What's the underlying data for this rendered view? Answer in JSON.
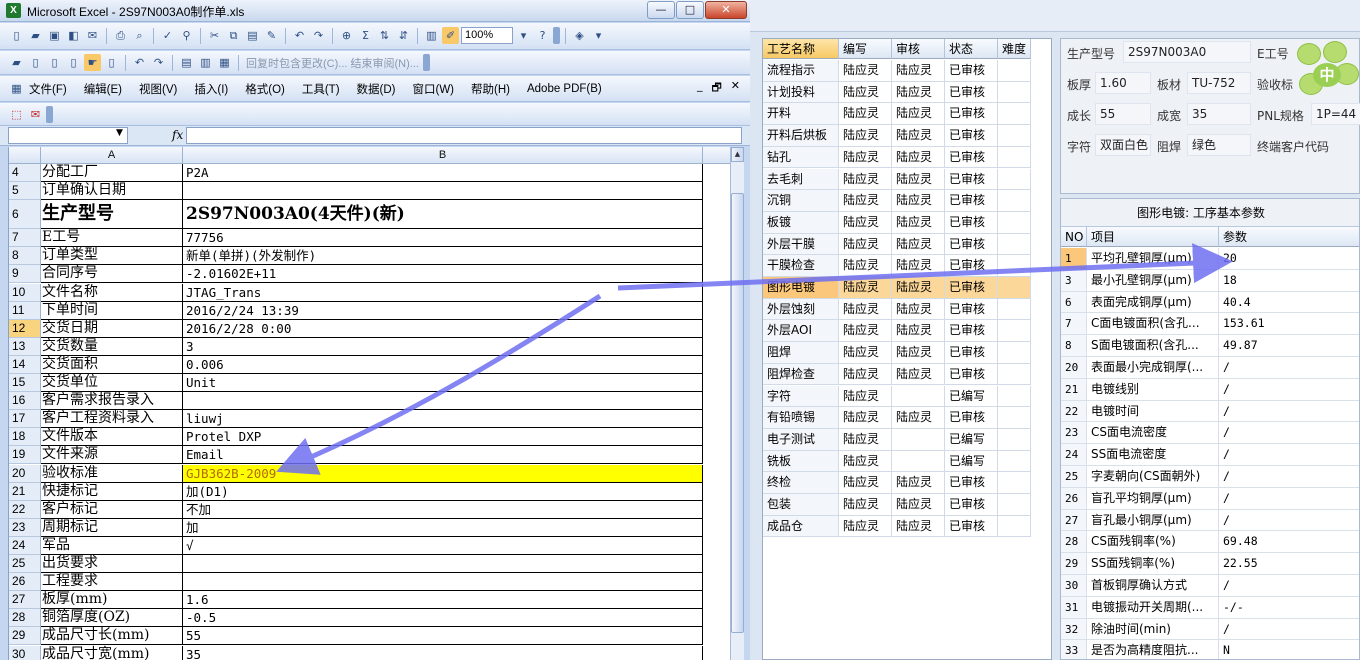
{
  "excel": {
    "title": "Microsoft Excel - 2S97N003A0制作单.xls",
    "app_icon": "X",
    "window_buttons": {
      "minimize": "—",
      "maximize": "□",
      "close": "✕"
    },
    "zoom": "100%",
    "toolbar2_disabled_text": "回复时包含更改(C)... 结束审阅(N)...",
    "menus": [
      "文件(F)",
      "编辑(E)",
      "视图(V)",
      "插入(I)",
      "格式(O)",
      "工具(T)",
      "数据(D)",
      "窗口(W)",
      "帮助(H)",
      "Adobe PDF(B)"
    ],
    "mdi_buttons": {
      "minimize": "_",
      "restore": "🗗",
      "close": "✕"
    },
    "fx": "fx",
    "columns": [
      "A",
      "B"
    ],
    "rows": [
      {
        "num": "4",
        "a": "分配工厂",
        "b": "P2A"
      },
      {
        "num": "5",
        "a": "订单确认日期",
        "b": ""
      },
      {
        "num": "6",
        "a": "生产型号",
        "b": "2S97N003A0(4天件)(新)"
      },
      {
        "num": "7",
        "a": "E工号",
        "b": "77756"
      },
      {
        "num": "8",
        "a": "订单类型",
        "b": "新单(单拼)(外发制作)"
      },
      {
        "num": "9",
        "a": "合同序号",
        "b": "-2.01602E+11"
      },
      {
        "num": "10",
        "a": "文件名称",
        "b": "JTAG_Trans"
      },
      {
        "num": "11",
        "a": "下单时间",
        "b": "2016/2/24 13:39"
      },
      {
        "num": "12",
        "a": "交货日期",
        "b": "2016/2/28 0:00"
      },
      {
        "num": "13",
        "a": "交货数量",
        "b": "3"
      },
      {
        "num": "14",
        "a": "交货面积",
        "b": "0.006"
      },
      {
        "num": "15",
        "a": "交货单位",
        "b": "Unit"
      },
      {
        "num": "16",
        "a": "客户需求报告录入",
        "b": ""
      },
      {
        "num": "17",
        "a": "客户工程资料录入",
        "b": "liuwj"
      },
      {
        "num": "18",
        "a": "文件版本",
        "b": "Protel DXP"
      },
      {
        "num": "19",
        "a": "文件来源",
        "b": "Email"
      },
      {
        "num": "20",
        "a": "验收标准",
        "b": "GJB362B-2009"
      },
      {
        "num": "21",
        "a": "快捷标记",
        "b": "加(D1)"
      },
      {
        "num": "22",
        "a": "客户标记",
        "b": "不加"
      },
      {
        "num": "23",
        "a": "周期标记",
        "b": "加"
      },
      {
        "num": "24",
        "a": "军品",
        "b": "√"
      },
      {
        "num": "25",
        "a": "出货要求",
        "b": ""
      },
      {
        "num": "26",
        "a": "工程要求",
        "b": ""
      },
      {
        "num": "27",
        "a": "板厚(mm)",
        "b": "1.6"
      },
      {
        "num": "28",
        "a": "铜箔厚度(OZ)",
        "b": "-0.5"
      },
      {
        "num": "29",
        "a": "成品尺寸长(mm)",
        "b": "55"
      },
      {
        "num": "30",
        "a": "成品尺寸宽(mm)",
        "b": "35"
      }
    ]
  },
  "process_table": {
    "headers": [
      "工艺名称",
      "编写",
      "审核",
      "状态",
      "难度"
    ],
    "rows": [
      [
        "流程指示",
        "陆应灵",
        "陆应灵",
        "已审核"
      ],
      [
        "计划投料",
        "陆应灵",
        "陆应灵",
        "已审核"
      ],
      [
        "开料",
        "陆应灵",
        "陆应灵",
        "已审核"
      ],
      [
        "开料后烘板",
        "陆应灵",
        "陆应灵",
        "已审核"
      ],
      [
        "钻孔",
        "陆应灵",
        "陆应灵",
        "已审核"
      ],
      [
        "去毛刺",
        "陆应灵",
        "陆应灵",
        "已审核"
      ],
      [
        "沉铜",
        "陆应灵",
        "陆应灵",
        "已审核"
      ],
      [
        "板镀",
        "陆应灵",
        "陆应灵",
        "已审核"
      ],
      [
        "外层干膜",
        "陆应灵",
        "陆应灵",
        "已审核"
      ],
      [
        "干膜检查",
        "陆应灵",
        "陆应灵",
        "已审核"
      ],
      [
        "图形电镀",
        "陆应灵",
        "陆应灵",
        "已审核"
      ],
      [
        "外层蚀刻",
        "陆应灵",
        "陆应灵",
        "已审核"
      ],
      [
        "外层AOI",
        "陆应灵",
        "陆应灵",
        "已审核"
      ],
      [
        "阻焊",
        "陆应灵",
        "陆应灵",
        "已审核"
      ],
      [
        "阻焊检查",
        "陆应灵",
        "陆应灵",
        "已审核"
      ],
      [
        "字符",
        "陆应灵",
        "",
        "已编写"
      ],
      [
        "有铅喷锡",
        "陆应灵",
        "陆应灵",
        "已审核"
      ],
      [
        "电子测试",
        "陆应灵",
        "",
        "已编写"
      ],
      [
        "铣板",
        "陆应灵",
        "",
        "已编写"
      ],
      [
        "终检",
        "陆应灵",
        "陆应灵",
        "已审核"
      ],
      [
        "包装",
        "陆应灵",
        "陆应灵",
        "已审核"
      ],
      [
        "成品仓",
        "陆应灵",
        "陆应灵",
        "已审核"
      ]
    ]
  },
  "info_panel": {
    "model_label": "生产型号",
    "model_value": "2S97N003A0",
    "e_label": "E工号",
    "thickness_label": "板厚",
    "thickness_value": "1.60",
    "material_label": "板材",
    "material_value": "TU-752",
    "accept_label": "验收标",
    "length_label": "成长",
    "length_value": "55",
    "width_label": "成宽",
    "width_value": "35",
    "pnl_label": "PNL规格",
    "pnl_value": "1P=44",
    "char_label": "字符",
    "char_value": "双面白色",
    "mask_label": "阻焊",
    "mask_value": "绿色",
    "endcust_label": "终端客户代码",
    "badge": "中"
  },
  "params_panel": {
    "title": "图形电镀: 工序基本参数",
    "headers": [
      "NO",
      "项目",
      "参数"
    ],
    "rows": [
      [
        "1",
        "平均孔壁铜厚(μm)",
        "20"
      ],
      [
        "3",
        "最小孔壁铜厚(μm)",
        "18"
      ],
      [
        "6",
        "表面完成铜厚(μm)",
        "40.4"
      ],
      [
        "7",
        "C面电镀面积(含孔...",
        "153.61"
      ],
      [
        "8",
        "S面电镀面积(含孔...",
        "49.87"
      ],
      [
        "20",
        "表面最小完成铜厚(...",
        "/"
      ],
      [
        "21",
        "电镀线别",
        "/"
      ],
      [
        "22",
        "电镀时间",
        "/"
      ],
      [
        "23",
        "CS面电流密度",
        "/"
      ],
      [
        "24",
        "SS面电流密度",
        "/"
      ],
      [
        "25",
        "字麦朝向(CS面朝外)",
        "/"
      ],
      [
        "26",
        "盲孔平均铜厚(μm)",
        "/"
      ],
      [
        "27",
        "盲孔最小铜厚(μm)",
        "/"
      ],
      [
        "28",
        "CS面残铜率(%)",
        "69.48"
      ],
      [
        "29",
        "SS面残铜率(%)",
        "22.55"
      ],
      [
        "30",
        "首板铜厚确认方式",
        "/"
      ],
      [
        "31",
        "电镀振动开关周期(...",
        "-/-"
      ],
      [
        "32",
        "除油时间(min)",
        "/"
      ],
      [
        "33",
        "是否为高精度阻抗...",
        "N"
      ]
    ]
  }
}
